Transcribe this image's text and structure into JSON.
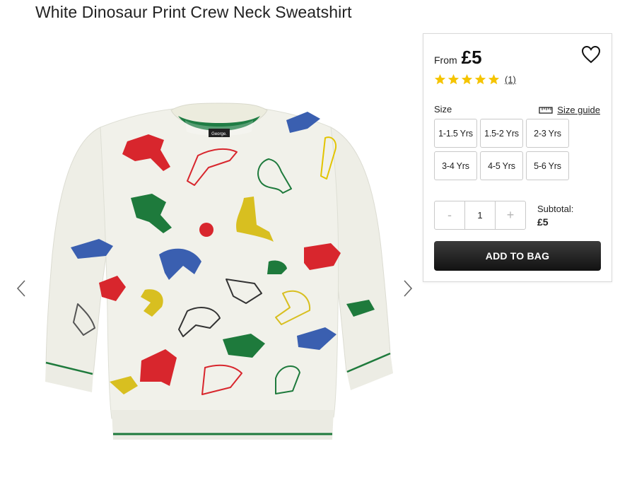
{
  "product": {
    "title": "White Dinosaur Print Crew Neck Sweatshirt",
    "image_alt": "White dinosaur print sweatshirt",
    "image_label": "George."
  },
  "gallery": {
    "prev_icon": "chevron-left-icon",
    "next_icon": "chevron-right-icon"
  },
  "panel": {
    "from_label": "From",
    "price": "£5",
    "wishlist_icon": "heart-icon",
    "rating": {
      "stars": 5,
      "max": 5,
      "count": "(1)"
    },
    "size_label": "Size",
    "size_guide_label": "Size guide",
    "sizes": [
      "1-1.5 Yrs",
      "1.5-2 Yrs",
      "2-3 Yrs",
      "3-4 Yrs",
      "4-5 Yrs",
      "5-6 Yrs"
    ],
    "quantity": {
      "minus": "-",
      "value": "1",
      "plus": "+"
    },
    "subtotal_label": "Subtotal:",
    "subtotal_value": "£5",
    "add_to_bag": "ADD TO BAG"
  },
  "colors": {
    "star": "#f5c400",
    "button": "#1e1e1e"
  }
}
